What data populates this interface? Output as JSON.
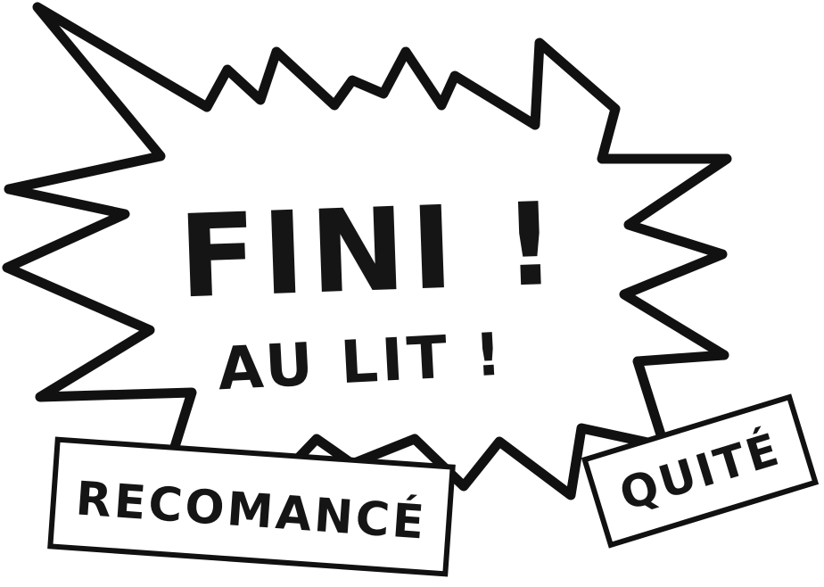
{
  "screen": {
    "title_line1": "FINI !",
    "title_line2": "AU LIT !"
  },
  "buttons": {
    "restart_label": "RECOMANCÉ",
    "quit_label": "QUITÉ"
  },
  "colors": {
    "ink": "#111111",
    "paper": "#ffffff"
  }
}
